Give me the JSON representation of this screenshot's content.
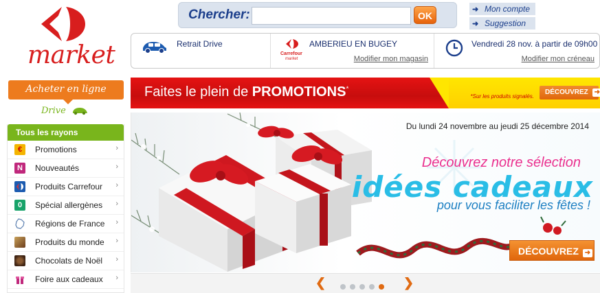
{
  "brand": {
    "name": "market",
    "color": "#d81e1e"
  },
  "search": {
    "label": "Chercher:",
    "value": "",
    "placeholder": "",
    "button": "OK"
  },
  "quick_links": [
    {
      "label": "Mon compte"
    },
    {
      "label": "Suggestion"
    }
  ],
  "info_bar": {
    "drive": {
      "title": "Retrait Drive",
      "icon": "car-icon"
    },
    "store": {
      "title": "AMBERIEU EN BUGEY",
      "link": "Modifier mon magasin",
      "logo_text": "Carrefour",
      "logo_sub": "market"
    },
    "slot": {
      "title": "Vendredi 28 nov. à partir de 09h00",
      "link": "Modifier mon créneau",
      "icon": "clock-icon"
    }
  },
  "nav": {
    "acheter": "Acheter en ligne",
    "drive": "Drive",
    "rayons_title": "Tous les rayons",
    "items": [
      {
        "label": "Promotions",
        "icon": "euro-icon",
        "color": "#f4b400",
        "glyph": "€"
      },
      {
        "label": "Nouveautés",
        "icon": "new-icon",
        "color": "#c0287c",
        "glyph": "N"
      },
      {
        "label": "Produits Carrefour",
        "icon": "carrefour-icon",
        "color": "#1c5bb0",
        "glyph": ""
      },
      {
        "label": "Spécial allergènes",
        "icon": "allergen-icon",
        "color": "#18a36a",
        "glyph": "0"
      },
      {
        "label": "Régions de France",
        "icon": "france-map-icon",
        "color": "#ffffff",
        "glyph": ""
      },
      {
        "label": "Produits du monde",
        "icon": "world-products-icon",
        "color": "#8a5a2b",
        "glyph": ""
      },
      {
        "label": "Chocolats de Noël",
        "icon": "chocolate-icon",
        "color": "#5a3a22",
        "glyph": ""
      },
      {
        "label": "Foire aux cadeaux",
        "icon": "gift-icon",
        "color": "#c0287c",
        "glyph": ""
      }
    ]
  },
  "promo": {
    "text_prefix": "Faites le plein de",
    "text_bold": "PROMOTIONS",
    "text_sup": "*",
    "note": "*Sur les produits signalés.",
    "button": "DÉCOUVREZ"
  },
  "hero": {
    "date": "Du lundi 24 novembre au jeudi 25 décembre 2014",
    "line1": "Découvrez notre sélection",
    "line2": "idées cadeaux",
    "line3": "pour vous faciliter les fêtes !",
    "button": "DÉCOUVREZ"
  },
  "carousel": {
    "slides": 5,
    "active_index": 4
  }
}
